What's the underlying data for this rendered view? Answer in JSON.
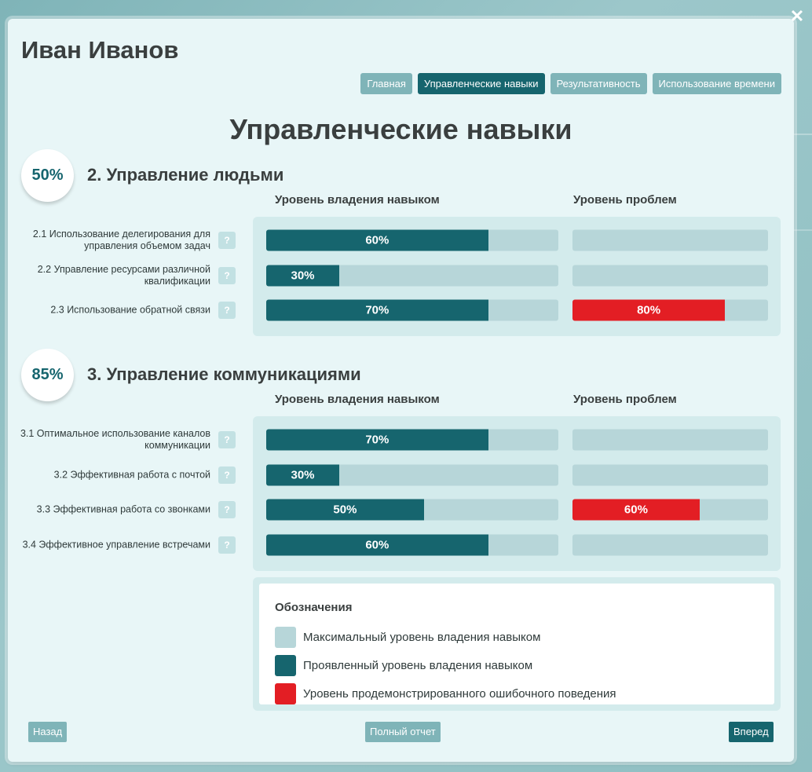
{
  "user": {
    "name": "Иван Иванов"
  },
  "close_icon": "close-icon",
  "tabs": [
    {
      "label": "Главная",
      "active": false
    },
    {
      "label": "Управленческие навыки",
      "active": true
    },
    {
      "label": "Результативность",
      "active": false
    },
    {
      "label": "Использование времени",
      "active": false
    }
  ],
  "page_title": "Управленческие навыки",
  "colors": {
    "max": "#b7d6d9",
    "shown": "#16656e",
    "problem": "#e31e24"
  },
  "columns": {
    "skill": "Уровень владения навыком",
    "problem": "Уровень проблем"
  },
  "help_label": "?",
  "sections": [
    {
      "score": "50%",
      "title": "2. Управление людьми",
      "rows": [
        {
          "label": "2.1 Использование делегирования для управления объемом задач",
          "skill": 0.76,
          "skill_label": "60%",
          "problem": 0,
          "problem_label": ""
        },
        {
          "label": "2.2 Управление ресурсами различной квалификации",
          "skill": 0.25,
          "skill_label": "30%",
          "problem": 0,
          "problem_label": ""
        },
        {
          "label": "2.3 Использование обратной связи",
          "skill": 0.76,
          "skill_label": "70%",
          "problem": 0.78,
          "problem_label": "80%"
        }
      ]
    },
    {
      "score": "85%",
      "title": "3. Управление коммуникациями",
      "rows": [
        {
          "label": "3.1 Оптимальное использование каналов коммуникации",
          "skill": 0.76,
          "skill_label": "70%",
          "problem": 0,
          "problem_label": ""
        },
        {
          "label": "3.2 Эффективная работа с почтой",
          "skill": 0.25,
          "skill_label": "30%",
          "problem": 0,
          "problem_label": ""
        },
        {
          "label": "3.3 Эффективная работа со звонками",
          "skill": 0.54,
          "skill_label": "50%",
          "problem": 0.65,
          "problem_label": "60%"
        },
        {
          "label": "3.4 Эффективное управление встречами",
          "skill": 0.76,
          "skill_label": "60%",
          "problem": 0,
          "problem_label": ""
        }
      ]
    }
  ],
  "legend": {
    "title": "Обозначения",
    "items": [
      {
        "label": "Максимальный уровень владения навыком",
        "color": "#b7d6d9"
      },
      {
        "label": "Проявленный уровень владения навыком",
        "color": "#16656e"
      },
      {
        "label": "Уровень продемонстрированного ошибочного поведения",
        "color": "#e31e24"
      }
    ]
  },
  "buttons": {
    "back": "Назад",
    "full_report": "Полный отчет",
    "next": "Вперед"
  }
}
